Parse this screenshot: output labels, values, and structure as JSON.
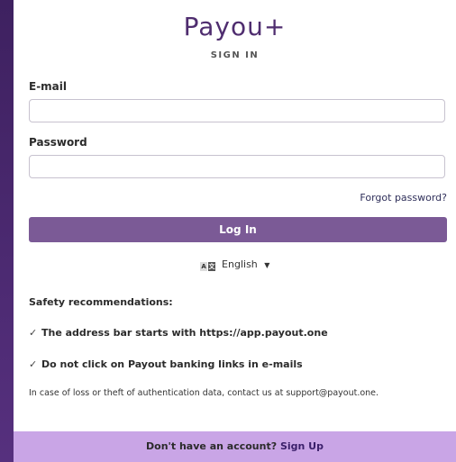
{
  "logo": {
    "text": "Payou+"
  },
  "header": {
    "title": "SIGN IN"
  },
  "form": {
    "email": {
      "label": "E-mail",
      "value": "",
      "placeholder": ""
    },
    "password": {
      "label": "Password",
      "value": "",
      "placeholder": ""
    },
    "forgot_label": "Forgot password?",
    "login_label": "Log In"
  },
  "language": {
    "icon": "translate-icon",
    "icon_left": "A",
    "icon_right": "文",
    "selected": "English"
  },
  "safety": {
    "title": "Safety recommendations:",
    "items": [
      "The address bar starts with https://app.payout.one",
      "Do not click on Payout banking links in e-mails"
    ],
    "note": "In case of loss or theft of authentication data, contact us at support@payout.one."
  },
  "footer": {
    "prompt": "Don't have an account?",
    "signup_label": "Sign Up"
  },
  "colors": {
    "accent": "#7b5a96",
    "brand": "#4f2d6f",
    "footer_bg": "#c9a5e6"
  }
}
